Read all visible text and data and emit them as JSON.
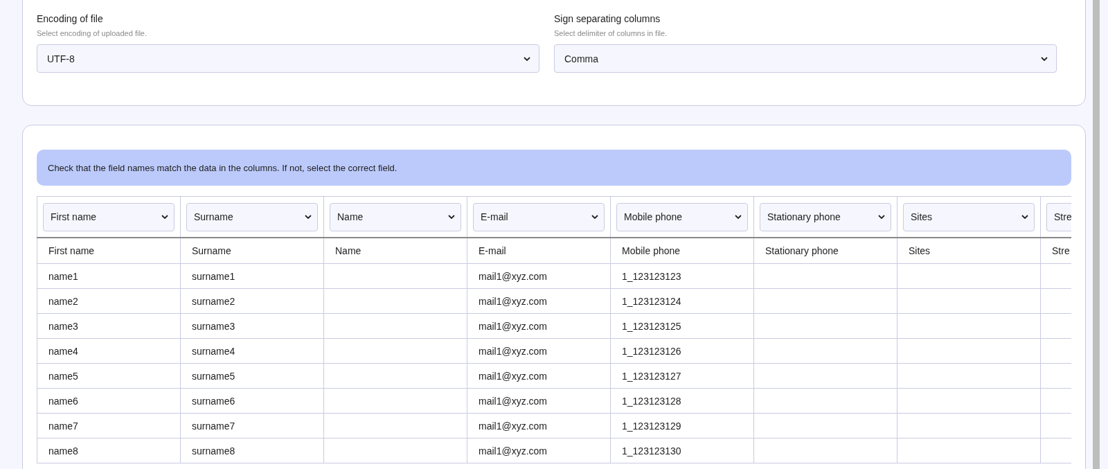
{
  "settings": [
    {
      "label": "Encoding of file",
      "hint": "Select encoding of uploaded file.",
      "value": "UTF-8"
    },
    {
      "label": "Sign separating columns",
      "hint": "Select delimiter of columns in file.",
      "value": "Comma"
    }
  ],
  "notice": "Check that the field names match the data in the columns. If not, select the correct field.",
  "table": {
    "columns": [
      {
        "field": "First name",
        "heading": "First name"
      },
      {
        "field": "Surname",
        "heading": "Surname"
      },
      {
        "field": "Name",
        "heading": "Name"
      },
      {
        "field": "E-mail",
        "heading": "E-mail"
      },
      {
        "field": "Mobile phone",
        "heading": "Mobile phone"
      },
      {
        "field": "Stationary phone",
        "heading": "Stationary phone"
      },
      {
        "field": "Sites",
        "heading": "Sites"
      },
      {
        "field": "Stre",
        "heading": "Stre"
      }
    ],
    "rows": [
      [
        "name1",
        "surname1",
        null,
        "mail1@xyz.com",
        "1_123123123",
        null,
        null,
        null
      ],
      [
        "name2",
        "surname2",
        null,
        "mail1@xyz.com",
        "1_123123124",
        null,
        null,
        null
      ],
      [
        "name3",
        "surname3",
        null,
        "mail1@xyz.com",
        "1_123123125",
        null,
        null,
        null
      ],
      [
        "name4",
        "surname4",
        null,
        "mail1@xyz.com",
        "1_123123126",
        null,
        null,
        null
      ],
      [
        "name5",
        "surname5",
        null,
        "mail1@xyz.com",
        "1_123123127",
        null,
        null,
        null
      ],
      [
        "name6",
        "surname6",
        null,
        "mail1@xyz.com",
        "1_123123128",
        null,
        null,
        null
      ],
      [
        "name7",
        "surname7",
        null,
        "mail1@xyz.com",
        "1_123123129",
        null,
        null,
        null
      ],
      [
        "name8",
        "surname8",
        null,
        "mail1@xyz.com",
        "1_123123130",
        null,
        null,
        null
      ]
    ]
  }
}
